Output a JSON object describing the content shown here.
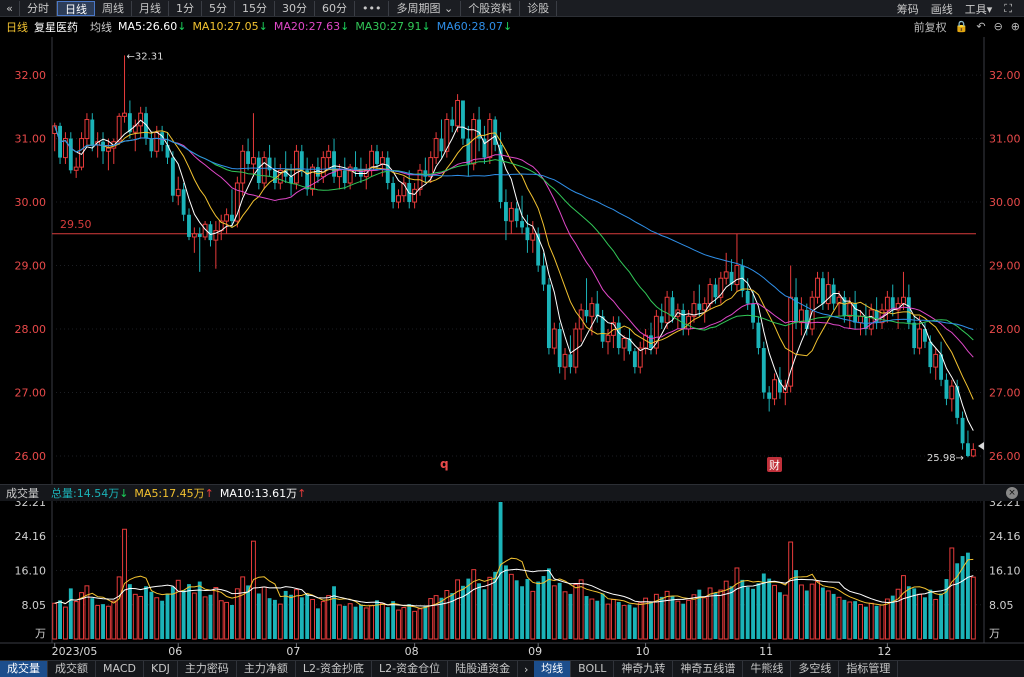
{
  "toolbar": {
    "back": "«",
    "items": [
      "分时",
      "日线",
      "周线",
      "月线",
      "1分",
      "5分",
      "15分",
      "30分",
      "60分",
      "•••",
      "多周期图 ⌄",
      "个股资料",
      "诊股"
    ],
    "active_index": 1,
    "right": [
      "筹码",
      "画线",
      "工具▾",
      "⛶"
    ]
  },
  "legend": {
    "period": "日线",
    "name": "复星医药",
    "ma_label": "均线",
    "ma5": "MA5:26.60",
    "ma10": "MA10:27.05",
    "ma20": "MA20:27.63",
    "ma30": "MA30:27.91",
    "ma60": "MA60:28.07",
    "arrow": "↓",
    "fq": "前复权",
    "colors": {
      "ma5": "#ffffff",
      "ma10": "#f2c230",
      "ma20": "#e048c8",
      "ma30": "#32c858",
      "ma60": "#2f8fe8"
    }
  },
  "vol_legend": {
    "title": "成交量",
    "total": "总量:14.54万",
    "total_arrow": "↓",
    "ma5": "MA5:17.45万",
    "ma5_arrow": "↑",
    "ma10": "MA10:13.61万",
    "ma10_arrow": "↑",
    "close": "×"
  },
  "tabs": {
    "left": [
      "成交量",
      "成交额",
      "MACD",
      "KDJ",
      "主力密码",
      "主力净额",
      "L2-资金抄底",
      "L2-资金仓位",
      "陆股通资金"
    ],
    "arrow": "›",
    "right": [
      "均线",
      "BOLL",
      "神奇九转",
      "神奇五线谱",
      "牛熊线",
      "多空线",
      "指标管理"
    ],
    "active_left": 0,
    "active_right": 0
  },
  "chart_data": {
    "type": "candlestick",
    "price_axis": {
      "min": 25.7,
      "max": 32.6,
      "ticks": [
        "32.00",
        "31.00",
        "30.00",
        "29.00",
        "28.00",
        "27.00",
        "26.00"
      ]
    },
    "volume_axis": {
      "unit": "万",
      "ticks": [
        "32.21",
        "24.16",
        "16.10",
        "8.05"
      ]
    },
    "x_labels": [
      "2023/05",
      "06",
      "07",
      "08",
      "09",
      "10",
      "11",
      "12"
    ],
    "hline": {
      "value": 29.5,
      "label": "29.50",
      "color": "#d83c3c"
    },
    "annotations": {
      "high": "←32.31",
      "low": "25.98→",
      "q_marker": "q",
      "cai_marker": "财"
    },
    "up_color": "#e83b3b",
    "down_color": "#1bb3b8",
    "candles": [
      [
        31.08,
        31.25,
        30.8,
        31.2,
        8.4
      ],
      [
        31.2,
        31.25,
        30.6,
        30.7,
        9.1
      ],
      [
        30.7,
        31.1,
        30.6,
        31.0,
        7.5
      ],
      [
        31.0,
        31.1,
        30.45,
        30.5,
        11.9
      ],
      [
        30.5,
        30.7,
        30.38,
        30.55,
        8.8
      ],
      [
        30.55,
        31.1,
        30.5,
        31.0,
        10.9
      ],
      [
        31.0,
        31.4,
        30.9,
        31.3,
        12.5
      ],
      [
        31.3,
        31.4,
        30.8,
        30.9,
        9.6
      ],
      [
        30.9,
        31.1,
        30.7,
        30.95,
        7.9
      ],
      [
        30.95,
        31.1,
        30.6,
        30.8,
        8.2
      ],
      [
        30.8,
        31.0,
        30.5,
        30.85,
        7.7
      ],
      [
        30.85,
        31.0,
        30.6,
        30.95,
        8.9
      ],
      [
        30.95,
        31.4,
        30.9,
        31.35,
        14.6
      ],
      [
        31.35,
        32.31,
        31.25,
        31.4,
        25.8
      ],
      [
        31.4,
        31.6,
        31.0,
        31.1,
        12.9
      ],
      [
        31.1,
        31.3,
        30.8,
        31.2,
        10.5
      ],
      [
        31.2,
        31.5,
        31.0,
        31.4,
        10.0
      ],
      [
        31.4,
        31.5,
        30.9,
        31.0,
        12.4
      ],
      [
        31.0,
        31.1,
        30.7,
        30.8,
        11.1
      ],
      [
        30.8,
        31.2,
        30.7,
        31.1,
        9.7
      ],
      [
        31.1,
        31.2,
        30.8,
        30.9,
        9.0
      ],
      [
        30.9,
        31.1,
        30.6,
        30.7,
        10.7
      ],
      [
        30.7,
        30.8,
        30.0,
        30.1,
        12.3
      ],
      [
        30.1,
        30.4,
        29.95,
        30.2,
        13.8
      ],
      [
        30.2,
        30.3,
        29.7,
        29.8,
        11.5
      ],
      [
        29.8,
        29.9,
        29.4,
        29.45,
        12.9
      ],
      [
        29.45,
        29.6,
        29.2,
        29.5,
        10.8
      ],
      [
        29.5,
        29.6,
        28.9,
        29.45,
        13.5
      ],
      [
        29.45,
        29.7,
        29.4,
        29.65,
        9.9
      ],
      [
        29.65,
        29.7,
        29.3,
        29.4,
        10.4
      ],
      [
        29.4,
        29.7,
        28.95,
        29.55,
        12.1
      ],
      [
        29.55,
        29.8,
        29.4,
        29.7,
        9.0
      ],
      [
        29.7,
        29.9,
        29.5,
        29.8,
        8.6
      ],
      [
        29.8,
        30.2,
        29.6,
        29.7,
        8.0
      ],
      [
        29.7,
        30.4,
        29.6,
        30.3,
        11.8
      ],
      [
        30.3,
        30.9,
        30.1,
        30.8,
        14.6
      ],
      [
        30.8,
        31.0,
        30.5,
        30.6,
        12.6
      ],
      [
        30.6,
        31.4,
        30.4,
        30.7,
        23.0
      ],
      [
        30.7,
        30.8,
        30.2,
        30.3,
        10.7
      ],
      [
        30.3,
        30.8,
        30.2,
        30.7,
        12.2
      ],
      [
        30.7,
        30.9,
        30.4,
        30.5,
        9.6
      ],
      [
        30.5,
        30.7,
        30.2,
        30.3,
        9.2
      ],
      [
        30.3,
        30.6,
        30.2,
        30.5,
        8.2
      ],
      [
        30.5,
        30.8,
        30.3,
        30.4,
        11.3
      ],
      [
        30.4,
        30.6,
        30.1,
        30.3,
        10.4
      ],
      [
        30.3,
        30.9,
        30.2,
        30.8,
        11.6
      ],
      [
        30.8,
        30.9,
        30.4,
        30.5,
        9.8
      ],
      [
        30.5,
        30.7,
        30.1,
        30.2,
        10.5
      ],
      [
        30.2,
        30.6,
        30.1,
        30.55,
        9.3
      ],
      [
        30.55,
        30.7,
        30.3,
        30.4,
        7.2
      ],
      [
        30.4,
        30.8,
        30.3,
        30.7,
        8.8
      ],
      [
        30.7,
        30.9,
        30.5,
        30.8,
        10.2
      ],
      [
        30.8,
        31.0,
        30.3,
        30.4,
        12.4
      ],
      [
        30.4,
        30.6,
        30.2,
        30.5,
        8.0
      ],
      [
        30.5,
        30.7,
        30.2,
        30.3,
        7.8
      ],
      [
        30.3,
        30.6,
        30.2,
        30.55,
        8.3
      ],
      [
        30.55,
        30.8,
        30.4,
        30.5,
        7.6
      ],
      [
        30.5,
        30.7,
        30.3,
        30.4,
        8.1
      ],
      [
        30.4,
        30.6,
        30.2,
        30.5,
        7.3
      ],
      [
        30.5,
        30.9,
        30.4,
        30.8,
        7.9
      ],
      [
        30.8,
        30.9,
        30.5,
        30.6,
        9.1
      ],
      [
        30.6,
        30.8,
        30.4,
        30.7,
        8.4
      ],
      [
        30.7,
        30.8,
        30.2,
        30.3,
        7.5
      ],
      [
        30.3,
        30.4,
        29.9,
        30.0,
        8.9
      ],
      [
        30.0,
        30.2,
        29.9,
        30.1,
        6.8
      ],
      [
        30.1,
        30.4,
        30.0,
        30.3,
        7.4
      ],
      [
        30.3,
        30.5,
        29.9,
        30.0,
        8.2
      ],
      [
        30.0,
        30.3,
        29.9,
        30.2,
        6.5
      ],
      [
        30.2,
        30.6,
        30.1,
        30.5,
        7.1
      ],
      [
        30.5,
        30.7,
        30.3,
        30.4,
        7.8
      ],
      [
        30.4,
        30.8,
        30.3,
        30.7,
        9.5
      ],
      [
        30.7,
        31.1,
        30.6,
        31.0,
        10.2
      ],
      [
        31.0,
        31.3,
        30.7,
        30.8,
        9.7
      ],
      [
        30.8,
        31.4,
        30.7,
        31.3,
        11.4
      ],
      [
        31.3,
        31.5,
        31.1,
        31.2,
        10.8
      ],
      [
        31.2,
        31.7,
        31.1,
        31.6,
        13.9
      ],
      [
        31.6,
        31.6,
        30.9,
        31.0,
        12.5
      ],
      [
        31.0,
        31.2,
        30.4,
        30.6,
        14.2
      ],
      [
        30.6,
        31.4,
        30.5,
        31.3,
        16.3
      ],
      [
        31.3,
        31.5,
        30.8,
        31.0,
        13.1
      ],
      [
        31.0,
        31.2,
        30.6,
        30.7,
        11.7
      ],
      [
        30.7,
        31.4,
        30.6,
        31.3,
        14.5
      ],
      [
        31.3,
        31.35,
        30.8,
        30.9,
        15.8
      ],
      [
        30.9,
        31.1,
        29.9,
        30.0,
        32.21
      ],
      [
        30.0,
        30.2,
        29.4,
        29.7,
        17.3
      ],
      [
        29.7,
        30.0,
        29.5,
        29.9,
        15.2
      ],
      [
        29.9,
        30.0,
        29.6,
        29.7,
        13.8
      ],
      [
        29.7,
        30.1,
        29.5,
        29.6,
        12.4
      ],
      [
        29.6,
        29.8,
        29.2,
        29.4,
        14.1
      ],
      [
        29.4,
        29.7,
        29.2,
        29.5,
        11.2
      ],
      [
        29.5,
        29.6,
        28.9,
        29.0,
        13.5
      ],
      [
        29.0,
        29.2,
        28.6,
        28.7,
        14.8
      ],
      [
        28.7,
        28.8,
        27.6,
        27.7,
        16.6
      ],
      [
        27.7,
        28.1,
        27.6,
        28.0,
        12.5
      ],
      [
        28.0,
        28.1,
        27.3,
        27.4,
        13.2
      ],
      [
        27.4,
        27.7,
        27.2,
        27.6,
        11.1
      ],
      [
        27.6,
        27.9,
        27.3,
        27.4,
        10.6
      ],
      [
        27.4,
        28.1,
        27.3,
        28.0,
        12.8
      ],
      [
        28.0,
        28.4,
        27.8,
        28.3,
        13.9
      ],
      [
        28.3,
        28.8,
        28.1,
        28.2,
        10.1
      ],
      [
        28.2,
        28.5,
        27.9,
        28.4,
        9.4
      ],
      [
        28.4,
        28.6,
        28.1,
        28.2,
        9.0
      ],
      [
        28.2,
        28.3,
        27.7,
        27.8,
        10.7
      ],
      [
        27.8,
        28.0,
        27.6,
        27.9,
        8.2
      ],
      [
        27.9,
        28.2,
        27.7,
        28.1,
        9.3
      ],
      [
        28.1,
        28.2,
        27.6,
        27.7,
        8.7
      ],
      [
        27.7,
        27.9,
        27.5,
        27.85,
        7.9
      ],
      [
        27.85,
        28.0,
        27.6,
        27.65,
        8.1
      ],
      [
        27.65,
        27.7,
        27.3,
        27.4,
        7.4
      ],
      [
        27.4,
        27.8,
        27.3,
        27.7,
        8.5
      ],
      [
        27.7,
        28.0,
        27.6,
        27.9,
        9.6
      ],
      [
        27.9,
        28.1,
        27.6,
        27.7,
        8.8
      ],
      [
        27.7,
        28.3,
        27.6,
        28.2,
        10.5
      ],
      [
        28.2,
        28.4,
        28.0,
        28.1,
        9.9
      ],
      [
        28.1,
        28.6,
        28.0,
        28.5,
        11.2
      ],
      [
        28.5,
        28.6,
        28.1,
        28.2,
        10.1
      ],
      [
        28.2,
        28.4,
        28.0,
        28.3,
        8.9
      ],
      [
        28.3,
        28.4,
        27.9,
        28.0,
        8.3
      ],
      [
        28.0,
        28.3,
        27.9,
        28.2,
        9.1
      ],
      [
        28.2,
        28.6,
        28.1,
        28.4,
        10.4
      ],
      [
        28.4,
        28.7,
        28.2,
        28.3,
        11.6
      ],
      [
        28.3,
        28.5,
        28.1,
        28.4,
        9.7
      ],
      [
        28.4,
        28.8,
        28.3,
        28.7,
        12.0
      ],
      [
        28.7,
        28.8,
        28.4,
        28.5,
        10.8
      ],
      [
        28.5,
        28.9,
        28.4,
        28.8,
        11.5
      ],
      [
        28.8,
        29.2,
        28.7,
        28.9,
        13.6
      ],
      [
        28.9,
        29.1,
        28.6,
        28.7,
        12.4
      ],
      [
        28.7,
        29.5,
        28.6,
        29.0,
        16.7
      ],
      [
        29.0,
        29.1,
        28.5,
        28.6,
        13.9
      ],
      [
        28.6,
        28.8,
        28.3,
        28.4,
        12.2
      ],
      [
        28.4,
        28.6,
        28.0,
        28.1,
        11.8
      ],
      [
        28.1,
        28.2,
        27.6,
        27.7,
        13.1
      ],
      [
        27.7,
        27.8,
        26.9,
        27.0,
        15.4
      ],
      [
        27.0,
        27.1,
        26.7,
        26.9,
        14.2
      ],
      [
        26.9,
        27.3,
        26.8,
        27.2,
        12.6
      ],
      [
        27.2,
        27.4,
        26.9,
        27.0,
        11.0
      ],
      [
        27.0,
        27.2,
        26.8,
        27.1,
        10.3
      ],
      [
        27.1,
        29.0,
        27.0,
        28.5,
        22.8
      ],
      [
        28.5,
        28.8,
        28.0,
        28.1,
        16.2
      ],
      [
        28.1,
        28.5,
        27.9,
        28.3,
        12.7
      ],
      [
        28.3,
        28.4,
        27.9,
        28.0,
        11.4
      ],
      [
        28.0,
        28.6,
        27.9,
        28.5,
        12.9
      ],
      [
        28.5,
        28.9,
        28.4,
        28.8,
        13.5
      ],
      [
        28.8,
        28.9,
        28.3,
        28.4,
        12.1
      ],
      [
        28.4,
        28.9,
        28.3,
        28.7,
        11.3
      ],
      [
        28.7,
        28.8,
        28.3,
        28.4,
        10.6
      ],
      [
        28.4,
        28.6,
        28.2,
        28.5,
        9.8
      ],
      [
        28.5,
        28.6,
        28.1,
        28.2,
        9.2
      ],
      [
        28.2,
        28.5,
        28.0,
        28.4,
        8.7
      ],
      [
        28.4,
        28.6,
        28.0,
        28.1,
        8.9
      ],
      [
        28.1,
        28.3,
        27.9,
        28.2,
        8.1
      ],
      [
        28.2,
        28.4,
        27.9,
        28.0,
        7.6
      ],
      [
        28.0,
        28.4,
        27.9,
        28.3,
        8.4
      ],
      [
        28.3,
        28.5,
        28.0,
        28.1,
        7.8
      ],
      [
        28.1,
        28.4,
        28.0,
        28.3,
        8.0
      ],
      [
        28.3,
        28.6,
        28.1,
        28.5,
        9.4
      ],
      [
        28.5,
        28.7,
        28.2,
        28.3,
        10.2
      ],
      [
        28.3,
        28.5,
        28.0,
        28.4,
        11.7
      ],
      [
        28.4,
        28.9,
        28.3,
        28.5,
        14.9
      ],
      [
        28.5,
        28.7,
        28.0,
        28.1,
        12.4
      ],
      [
        28.1,
        28.2,
        27.6,
        27.7,
        11.9
      ],
      [
        27.7,
        28.2,
        27.6,
        28.0,
        10.5
      ],
      [
        28.0,
        28.1,
        27.7,
        27.8,
        9.8
      ],
      [
        27.8,
        27.9,
        27.3,
        27.4,
        11.6
      ],
      [
        27.4,
        27.7,
        27.2,
        27.6,
        9.3
      ],
      [
        27.6,
        27.8,
        27.1,
        27.2,
        10.7
      ],
      [
        27.2,
        27.3,
        26.8,
        26.9,
        14.1
      ],
      [
        26.9,
        27.2,
        26.7,
        27.1,
        21.4
      ],
      [
        27.1,
        27.2,
        26.5,
        26.6,
        17.8
      ],
      [
        26.6,
        26.7,
        26.1,
        26.2,
        19.5
      ],
      [
        26.2,
        26.4,
        25.98,
        26.0,
        20.3
      ],
      [
        26.0,
        26.2,
        25.98,
        26.1,
        14.54
      ]
    ]
  }
}
